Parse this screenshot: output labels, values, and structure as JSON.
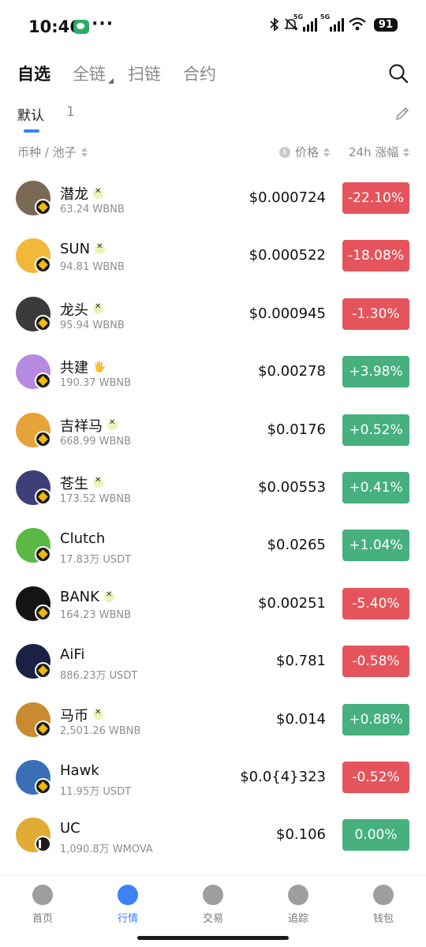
{
  "status_bar": {
    "time": "10:46",
    "battery": "91",
    "net1": "5G",
    "net2": "5G"
  },
  "top_tabs": [
    {
      "label": "自选",
      "active": true
    },
    {
      "label": "全链",
      "active": false
    },
    {
      "label": "扫链",
      "active": false
    },
    {
      "label": "合约",
      "active": false
    }
  ],
  "sub_tabs": [
    {
      "label": "默认",
      "active": true
    },
    {
      "label": "1",
      "active": false
    }
  ],
  "columns": {
    "pair": "币种 / 池子",
    "price": "价格",
    "change": "24h 涨幅"
  },
  "rows": [
    {
      "name": "潜龙",
      "pool": "63.24 WBNB",
      "price": "$0.000724",
      "change": "-22.10%",
      "dir": "down",
      "badge": "verify",
      "chain": "bnb",
      "avatar": "#7a6a55"
    },
    {
      "name": "SUN",
      "pool": "94.81 WBNB",
      "price": "$0.000522",
      "change": "-18.08%",
      "dir": "down",
      "badge": "verify",
      "chain": "bnb",
      "avatar": "#f2b83a"
    },
    {
      "name": "龙头",
      "pool": "95.94 WBNB",
      "price": "$0.000945",
      "change": "-1.30%",
      "dir": "down",
      "badge": "verify",
      "chain": "bnb",
      "avatar": "#3b3b3b"
    },
    {
      "name": "共建",
      "pool": "190.37 WBNB",
      "price": "$0.00278",
      "change": "+3.98%",
      "dir": "up",
      "badge": "hand",
      "chain": "bnb",
      "avatar": "#b58adf"
    },
    {
      "name": "吉祥马",
      "pool": "668.99 WBNB",
      "price": "$0.0176",
      "change": "+0.52%",
      "dir": "up",
      "badge": "verify",
      "chain": "bnb",
      "avatar": "#e5a33a"
    },
    {
      "name": "苍生",
      "pool": "173.52 WBNB",
      "price": "$0.00553",
      "change": "+0.41%",
      "dir": "up",
      "badge": "verify",
      "chain": "bnb",
      "avatar": "#3c3f78"
    },
    {
      "name": "Clutch",
      "pool": "17.83万 USDT",
      "price": "$0.0265",
      "change": "+1.04%",
      "dir": "up",
      "badge": "",
      "chain": "bnb",
      "avatar": "#5cb844"
    },
    {
      "name": "BANK",
      "pool": "164.23 WBNB",
      "price": "$0.00251",
      "change": "-5.40%",
      "dir": "down",
      "badge": "verify",
      "chain": "bnb",
      "avatar": "#141414"
    },
    {
      "name": "AiFi",
      "pool": "886.23万 USDT",
      "price": "$0.781",
      "change": "-0.58%",
      "dir": "down",
      "badge": "",
      "chain": "bnb",
      "avatar": "#1b2145"
    },
    {
      "name": "马币",
      "pool": "2,501.26 WBNB",
      "price": "$0.014",
      "change": "+0.88%",
      "dir": "up",
      "badge": "verify",
      "chain": "bnb",
      "avatar": "#c98a30"
    },
    {
      "name": "Hawk",
      "pool": "11.95万 USDT",
      "price": "$0.0{4}323",
      "change": "-0.52%",
      "dir": "down",
      "badge": "",
      "chain": "bnb",
      "avatar": "#3a6fb5"
    },
    {
      "name": "UC",
      "pool": "1,090.8万 WMOVA",
      "price": "$0.106",
      "change": "0.00%",
      "dir": "up",
      "badge": "",
      "chain": "w",
      "avatar": "#e1ac35"
    }
  ],
  "bottom_nav": [
    {
      "label": "首页",
      "icon": "home-icon",
      "active": false
    },
    {
      "label": "行情",
      "icon": "market-icon",
      "active": true
    },
    {
      "label": "交易",
      "icon": "swap-icon",
      "active": false
    },
    {
      "label": "追踪",
      "icon": "compass-icon",
      "active": false
    },
    {
      "label": "钱包",
      "icon": "wallet-icon",
      "active": false
    }
  ],
  "colors": {
    "up": "#46b07f",
    "down": "#e5545c",
    "accent": "#3b82f6"
  }
}
